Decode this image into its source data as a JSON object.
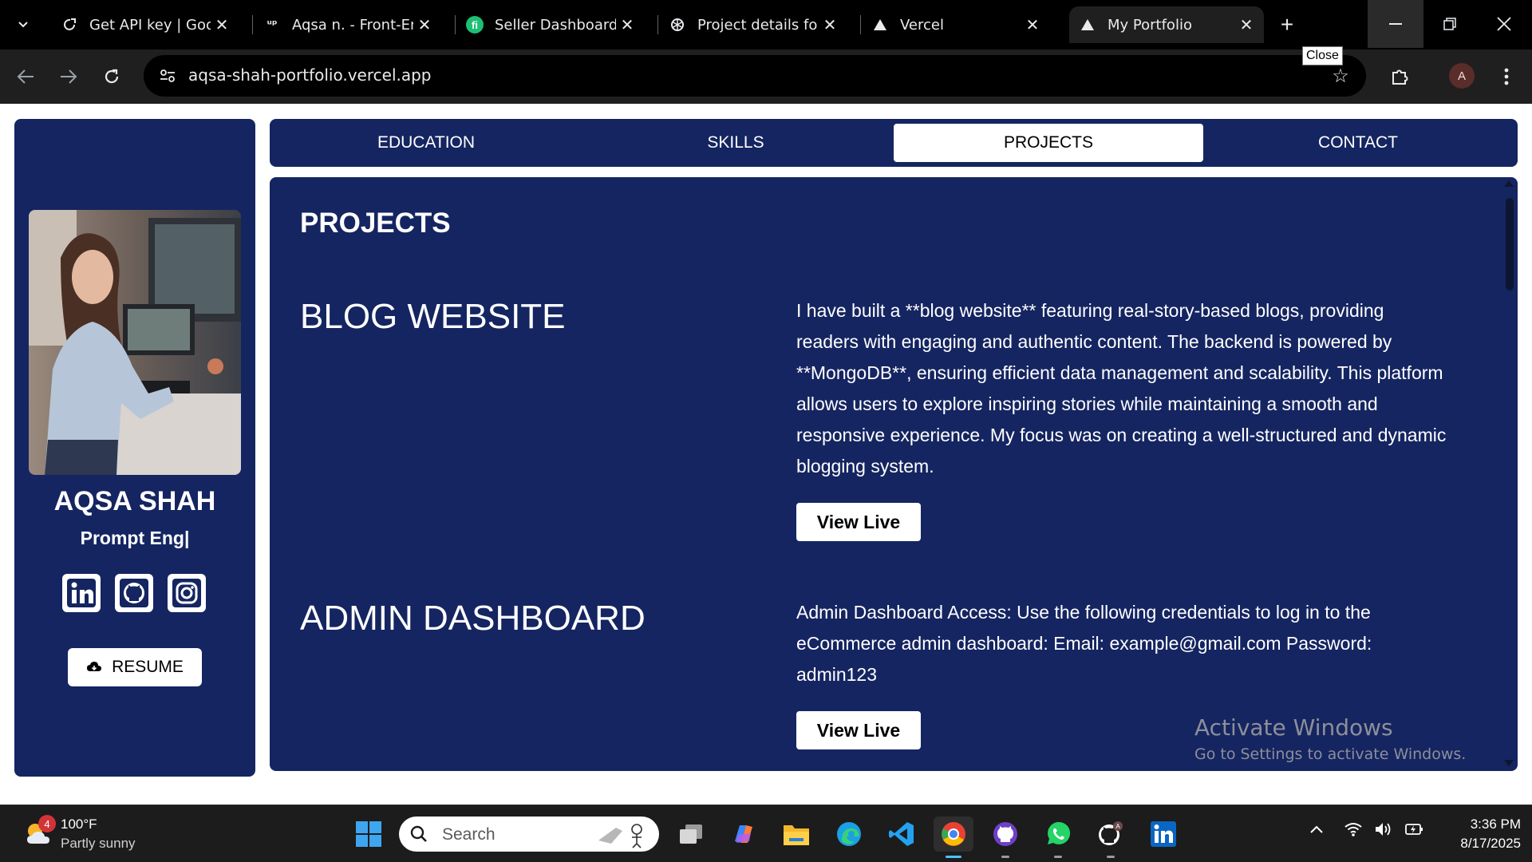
{
  "browser": {
    "tabs": [
      {
        "title": "Get API key | Goog",
        "icon": "key-link-icon",
        "active": false
      },
      {
        "title": "Aqsa n. - Front-Enc",
        "icon": "upwork-icon",
        "active": false
      },
      {
        "title": "Seller Dashboard",
        "icon": "fiverr-icon",
        "active": false
      },
      {
        "title": "Project details form",
        "icon": "openai-icon",
        "active": false
      },
      {
        "title": "Vercel",
        "icon": "vercel-icon",
        "active": false
      },
      {
        "title": "My Portfolio",
        "icon": "vercel-icon",
        "active": true
      }
    ],
    "url": "aqsa-shah-portfolio.vercel.app",
    "tooltip": "Close",
    "profile_initial": "A"
  },
  "sidebar": {
    "name": "AQSA SHAH",
    "role": "Prompt Eng|",
    "socials": [
      "linkedin-icon",
      "github-icon",
      "instagram-icon"
    ],
    "resume_label": "RESUME"
  },
  "nav": {
    "tabs": [
      "EDUCATION",
      "SKILLS",
      "PROJECTS",
      "CONTACT"
    ],
    "active": "PROJECTS"
  },
  "content": {
    "section_title": "PROJECTS",
    "projects": [
      {
        "name": "BLOG WEBSITE",
        "description": "I have built a **blog website** featuring real-story-based blogs, providing readers with engaging and authentic content. The backend is powered by **MongoDB**, ensuring efficient data management and scalability. This platform allows users to explore inspiring stories while maintaining a smooth and responsive experience. My focus was on creating a well-structured and dynamic blogging system.",
        "button": "View Live"
      },
      {
        "name": "ADMIN DASHBOARD",
        "description": "Admin Dashboard Access: Use the following credentials to log in to the eCommerce admin dashboard: Email: example@gmail.com Password: admin123",
        "button": "View Live"
      }
    ]
  },
  "watermark": {
    "line1": "Activate Windows",
    "line2": "Go to Settings to activate Windows."
  },
  "taskbar": {
    "weather_temp": "100°F",
    "weather_cond": "Partly sunny",
    "weather_badge": "4",
    "search_placeholder": "Search",
    "time": "3:36 PM",
    "date": "8/17/2025"
  }
}
